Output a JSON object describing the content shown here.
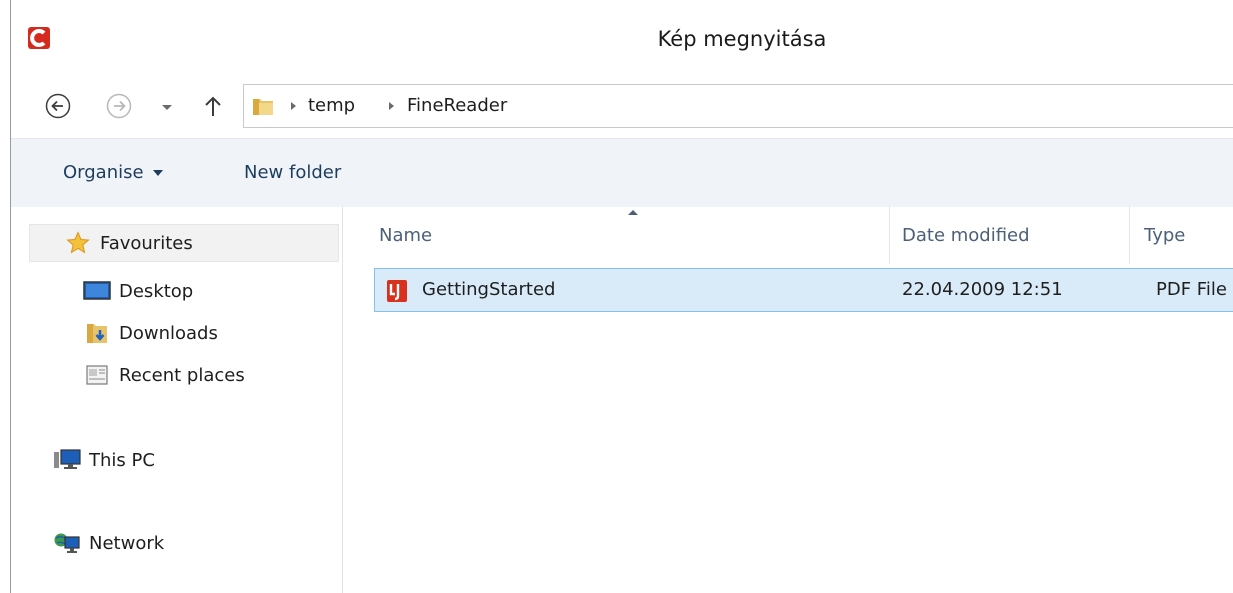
{
  "window": {
    "title": "Kép megnyitása"
  },
  "address": {
    "crumbs": [
      "temp",
      "FineReader"
    ]
  },
  "toolbar": {
    "organise_label": "Organise",
    "new_folder_label": "New folder"
  },
  "nav": {
    "items": [
      {
        "label": "Favourites",
        "icon": "star-icon"
      },
      {
        "label": "Desktop",
        "icon": "desktop-icon"
      },
      {
        "label": "Downloads",
        "icon": "downloads-folder-icon"
      },
      {
        "label": "Recent places",
        "icon": "recent-places-icon"
      },
      {
        "label": "This PC",
        "icon": "computer-icon"
      },
      {
        "label": "Network",
        "icon": "network-icon"
      }
    ]
  },
  "columns": {
    "name": "Name",
    "date": "Date modified",
    "type": "Type"
  },
  "files": [
    {
      "name": "GettingStarted",
      "date": "22.04.2009 12:51",
      "type": "PDF File",
      "icon": "pdf-file-icon"
    }
  ],
  "colors": {
    "selection": "#d9ebf9",
    "selection_border": "#7fc3ee",
    "toolbar": "#f0f4f9"
  }
}
